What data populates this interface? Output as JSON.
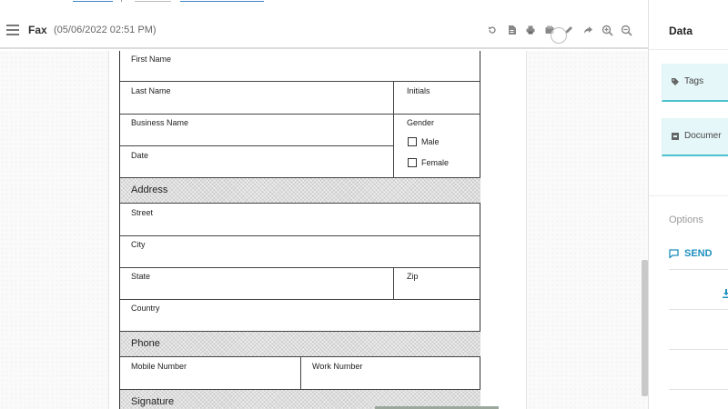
{
  "toolbar": {
    "title": "Fax",
    "date": "(05/06/2022 02:51 PM)",
    "icons": [
      "rotate-icon",
      "document-icon",
      "print-icon",
      "fax-icon",
      "pen-icon",
      "share-icon",
      "zoom-in-icon",
      "zoom-out-icon"
    ]
  },
  "form": {
    "first_name": "First Name",
    "last_name": "Last Name",
    "initials": "Initials",
    "business_name": "Business Name",
    "gender": "Gender",
    "male": "Male",
    "female": "Female",
    "date": "Date",
    "address_section": "Address",
    "street": "Street",
    "city": "City",
    "state": "State",
    "zip": "Zip",
    "country": "Country",
    "phone_section": "Phone",
    "mobile_number": "Mobile Number",
    "work_number": "Work Number",
    "signature_section": "Signature"
  },
  "panel": {
    "title": "Data",
    "tags_label": "Tags",
    "documents_label": "Documer",
    "options_label": "Options",
    "send_label": "SEND"
  },
  "colors": {
    "accent": "#1e8fbf",
    "button_bg": "#e6f7f9",
    "button_border": "#4cc1cd"
  }
}
